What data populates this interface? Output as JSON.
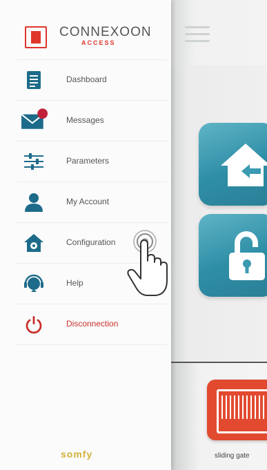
{
  "app": {
    "brand": {
      "name": "CONNEXOON",
      "sub": "ACCESS"
    },
    "footer_logo": "somfy",
    "colors": {
      "accent": "#e0352b",
      "menu_icon": "#1d6b8a",
      "tile": "#3a9ab2",
      "gate_card": "#e24a30",
      "badge": "#c0203a"
    }
  },
  "sidebar": {
    "items": [
      {
        "label": "Dashboard",
        "icon": "document-icon"
      },
      {
        "label": "Messages",
        "icon": "envelope-icon",
        "badge": "1"
      },
      {
        "label": "Parameters",
        "icon": "sliders-icon"
      },
      {
        "label": "My Account",
        "icon": "user-icon"
      },
      {
        "label": "Configuration",
        "icon": "house-gear-icon"
      },
      {
        "label": "Help",
        "icon": "headset-icon"
      },
      {
        "label": "Disconnection",
        "icon": "power-icon"
      }
    ]
  },
  "main": {
    "devices": [
      {
        "label": "sliding gate"
      }
    ]
  }
}
